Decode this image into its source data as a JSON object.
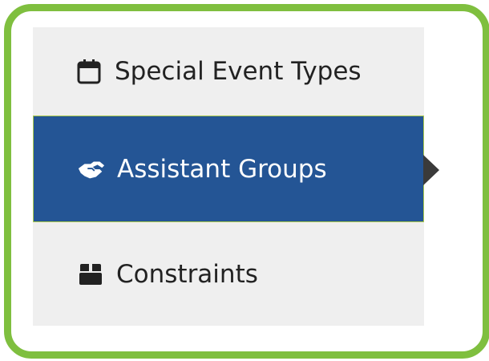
{
  "menu": {
    "items": [
      {
        "label": "Special Event Types",
        "icon": "calendar-icon",
        "active": false
      },
      {
        "label": "Assistant Groups",
        "icon": "handshake-icon",
        "active": true
      },
      {
        "label": "Constraints",
        "icon": "box-icon",
        "active": false
      }
    ]
  },
  "colors": {
    "frame_border": "#7fbf3f",
    "menu_background": "#efefef",
    "active_background": "#245595",
    "active_text": "#ffffff",
    "text": "#222222",
    "pointer_arrow": "#3a3a3a"
  }
}
